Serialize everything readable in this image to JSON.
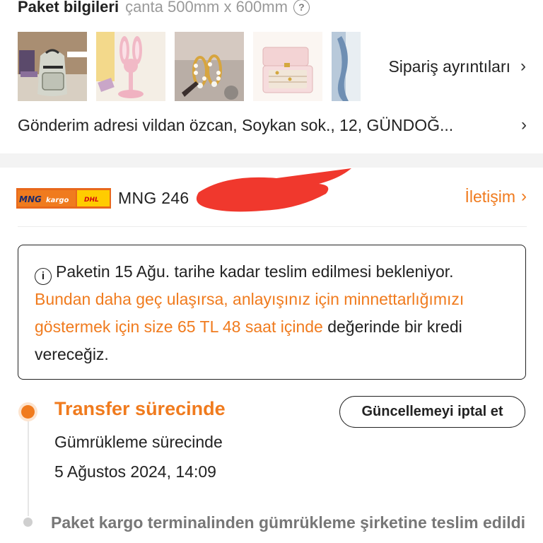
{
  "package": {
    "title": "Paket bilgileri",
    "size": "çanta 500mm x 600mm",
    "help_glyph": "?"
  },
  "thumbnails": [
    {
      "name": "backpack"
    },
    {
      "name": "bunny-phone-stand"
    },
    {
      "name": "pearl-earrings"
    },
    {
      "name": "pink-jewelry-box"
    },
    {
      "name": "partial-item"
    }
  ],
  "order_details": {
    "label": "Sipariş ayrıntıları",
    "chevron": "›"
  },
  "address": {
    "text": "Gönderim adresi vildan özcan, Soykan sok., 12, GÜNDOĞ...",
    "chevron": "›"
  },
  "carrier": {
    "logo_left": "MNG",
    "logo_mid": "kargo",
    "logo_right": "DHL",
    "tracking": "MNG 246",
    "contact_label": "İletişim",
    "chevron": "›"
  },
  "notice": {
    "info_glyph": "i",
    "part1": "Paketin 15 Ağu. tarihe kadar teslim edilmesi bekleniyor. ",
    "highlight": "Bundan daha geç ulaşırsa, anlayışınız için minnettarlığımızı göstermek için size 65 TL 48 saat içinde",
    "part2": " değerinde bir kredi vereceğiz."
  },
  "status": {
    "title": "Transfer sürecinde",
    "subtitle": "Gümrükleme sürecinde",
    "timestamp": "5 Ağustos 2024, 14:09",
    "cancel_button": "Güncellemeyi iptal et"
  },
  "next_event": {
    "text": "Paket kargo terminalinden gümrükleme şirketine teslim edildi"
  },
  "colors": {
    "accent": "#f07b1e",
    "border": "#222222",
    "divider": "#f3f3f3"
  }
}
